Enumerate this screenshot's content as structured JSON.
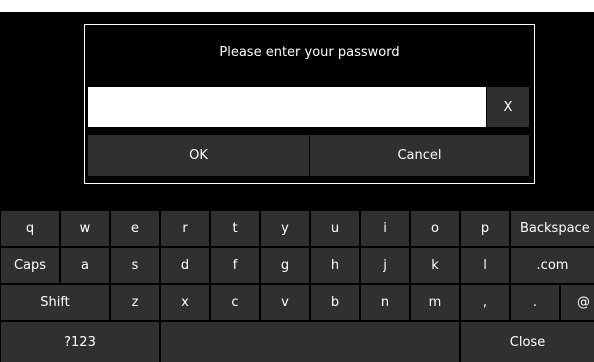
{
  "dialog": {
    "title": "Please enter your password",
    "password_value": "",
    "clear_label": "X",
    "ok_label": "OK",
    "cancel_label": "Cancel"
  },
  "keyboard": {
    "rows": [
      [
        "q",
        "w",
        "e",
        "r",
        "t",
        "y",
        "u",
        "i",
        "o",
        "p",
        "Backspace"
      ],
      [
        "Caps",
        "a",
        "s",
        "d",
        "f",
        "g",
        "h",
        "j",
        "k",
        "l",
        ".com"
      ],
      [
        "Shift",
        "z",
        "x",
        "c",
        "v",
        "b",
        "n",
        "m",
        ",",
        ".",
        "@"
      ],
      [
        "?123",
        "",
        "Close"
      ]
    ]
  },
  "colors": {
    "background": "#000000",
    "key": "#303030",
    "text": "#ffffff",
    "input": "#ffffff"
  }
}
